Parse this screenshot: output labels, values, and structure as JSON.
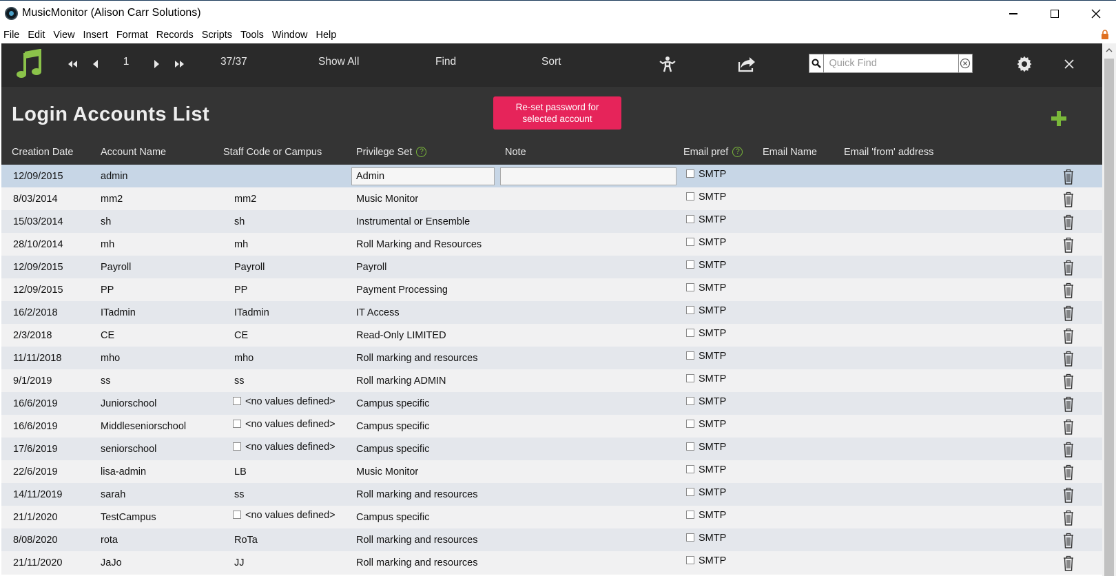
{
  "window": {
    "title": "MusicMonitor (Alison Carr Solutions)"
  },
  "menu": [
    "File",
    "Edit",
    "View",
    "Insert",
    "Format",
    "Records",
    "Scripts",
    "Tools",
    "Window",
    "Help"
  ],
  "toolbar": {
    "record_number": "1",
    "record_count": "37/37",
    "show_all": "Show All",
    "find": "Find",
    "sort": "Sort",
    "quick_find_placeholder": "Quick Find"
  },
  "header": {
    "title": "Login Accounts List",
    "reset_button": "Re-set password for selected account",
    "columns": {
      "creation_date": "Creation Date",
      "account_name": "Account Name",
      "staff_code": "Staff Code or Campus",
      "privilege_set": "Privilege Set",
      "note": "Note",
      "email_pref": "Email pref",
      "email_name": "Email Name",
      "email_from": "Email 'from' address"
    },
    "help_glyph": "?"
  },
  "rows": [
    {
      "date": "12/09/2015",
      "account": "admin",
      "staff": "",
      "staff_checkbox": false,
      "privilege": "Admin",
      "email_pref": "SMTP"
    },
    {
      "date": "8/03/2014",
      "account": "mm2",
      "staff": "mm2",
      "staff_checkbox": false,
      "privilege": "Music Monitor",
      "email_pref": "SMTP"
    },
    {
      "date": "15/03/2014",
      "account": "sh",
      "staff": "sh",
      "staff_checkbox": false,
      "privilege": "Instrumental or Ensemble",
      "email_pref": "SMTP"
    },
    {
      "date": "28/10/2014",
      "account": "mh",
      "staff": "mh",
      "staff_checkbox": false,
      "privilege": "Roll Marking and Resources",
      "email_pref": "SMTP"
    },
    {
      "date": "12/09/2015",
      "account": "Payroll",
      "staff": "Payroll",
      "staff_checkbox": false,
      "privilege": "Payroll",
      "email_pref": "SMTP"
    },
    {
      "date": "12/09/2015",
      "account": "PP",
      "staff": "PP",
      "staff_checkbox": false,
      "privilege": "Payment Processing",
      "email_pref": "SMTP"
    },
    {
      "date": "16/2/2018",
      "account": "ITadmin",
      "staff": "ITadmin",
      "staff_checkbox": false,
      "privilege": "IT Access",
      "email_pref": "SMTP"
    },
    {
      "date": "2/3/2018",
      "account": "CE",
      "staff": "CE",
      "staff_checkbox": false,
      "privilege": "Read-Only LIMITED",
      "email_pref": "SMTP"
    },
    {
      "date": "11/11/2018",
      "account": "mho",
      "staff": "mho",
      "staff_checkbox": false,
      "privilege": "Roll marking and resources",
      "email_pref": "SMTP"
    },
    {
      "date": "9/1/2019",
      "account": "ss",
      "staff": "ss",
      "staff_checkbox": false,
      "privilege": "Roll marking ADMIN",
      "email_pref": "SMTP"
    },
    {
      "date": "16/6/2019",
      "account": "Juniorschool",
      "staff": "<no values defined>",
      "staff_checkbox": true,
      "privilege": "Campus specific",
      "email_pref": "SMTP"
    },
    {
      "date": "16/6/2019",
      "account": "Middleseniorschool",
      "staff": "<no values defined>",
      "staff_checkbox": true,
      "privilege": "Campus specific",
      "email_pref": "SMTP"
    },
    {
      "date": "17/6/2019",
      "account": "seniorschool",
      "staff": "<no values defined>",
      "staff_checkbox": true,
      "privilege": "Campus specific",
      "email_pref": "SMTP"
    },
    {
      "date": "22/6/2019",
      "account": "lisa-admin",
      "staff": "LB",
      "staff_checkbox": false,
      "privilege": "Music Monitor",
      "email_pref": "SMTP"
    },
    {
      "date": "14/11/2019",
      "account": "sarah",
      "staff": "ss",
      "staff_checkbox": false,
      "privilege": "Roll marking and resources",
      "email_pref": "SMTP"
    },
    {
      "date": "21/1/2020",
      "account": "TestCampus",
      "staff": "<no values defined>",
      "staff_checkbox": true,
      "privilege": "Campus specific",
      "email_pref": "SMTP"
    },
    {
      "date": "8/08/2020",
      "account": "rota",
      "staff": "RoTa",
      "staff_checkbox": false,
      "privilege": "Roll marking and resources",
      "email_pref": "SMTP"
    },
    {
      "date": "21/11/2020",
      "account": "JaJo",
      "staff": "JJ",
      "staff_checkbox": false,
      "privilege": "Roll marking and resources",
      "email_pref": "SMTP"
    }
  ],
  "colors": {
    "toolbar_bg": "#2a2a2a",
    "header_bg": "#343434",
    "accent_green": "#7ab83a",
    "reset_button": "#e6245a",
    "selected_row": "#c7d6e6"
  },
  "icons": {
    "app": "musicmonitor-app-icon",
    "logo": "music-note-icon",
    "first": "first-record-icon",
    "prev": "previous-record-icon",
    "next": "next-record-icon",
    "last": "last-record-icon",
    "shrug": "shrug-person-icon",
    "share": "share-icon",
    "search": "search-icon",
    "clear": "clear-icon",
    "settings": "gear-icon",
    "close": "close-icon",
    "add": "plus-icon",
    "delete": "trash-icon",
    "lock": "lock-icon"
  }
}
